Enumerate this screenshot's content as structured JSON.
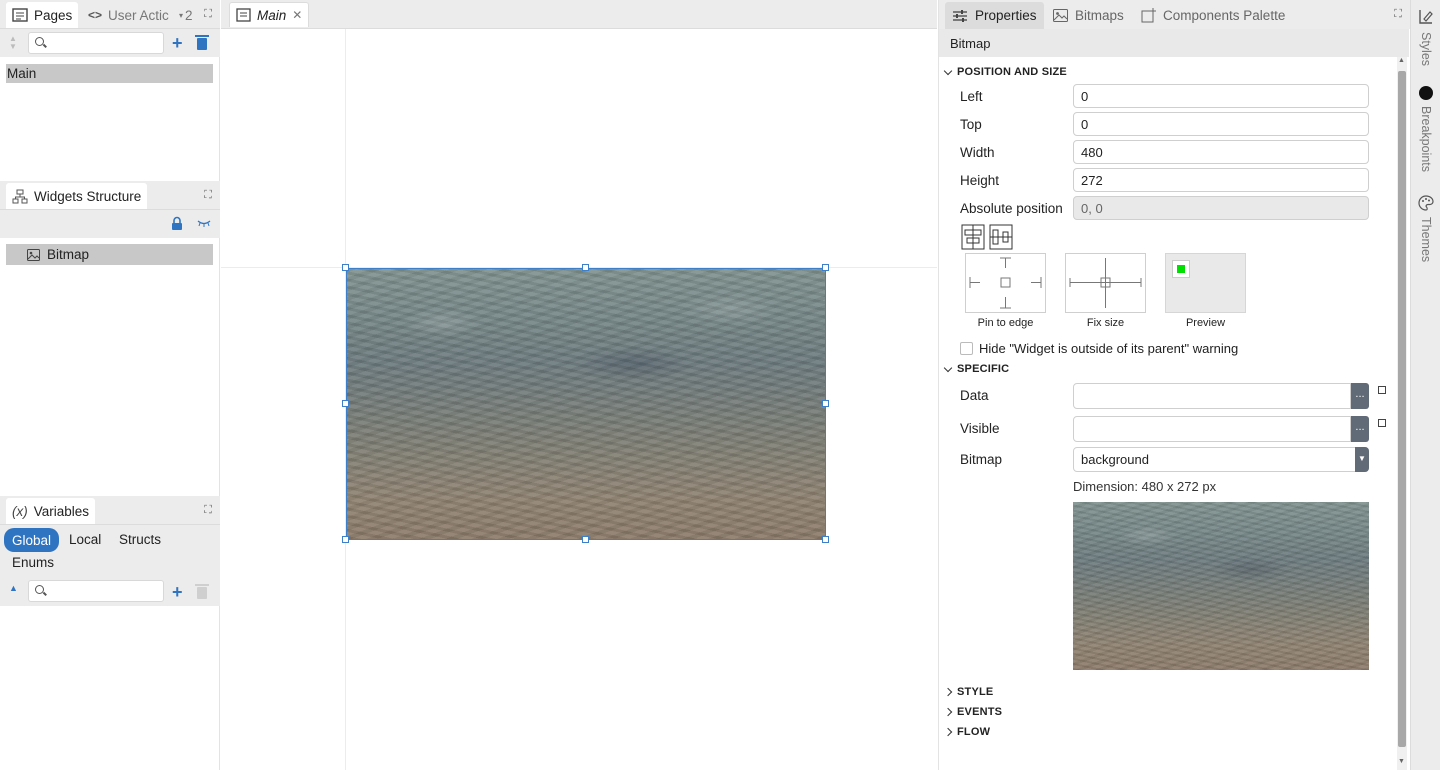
{
  "left": {
    "pages_panel": {
      "tab_pages": "Pages",
      "tab_user_actions": "User Actic",
      "overflow_count": "2",
      "search_placeholder": "",
      "items": [
        "Main"
      ]
    },
    "widgets_panel": {
      "title": "Widgets Structure",
      "items": [
        "Bitmap"
      ]
    },
    "variables_panel": {
      "icon_text": "(x)",
      "title": "Variables",
      "tabs": [
        "Global",
        "Local",
        "Structs",
        "Enums"
      ],
      "active_tab": "Global",
      "search_placeholder": ""
    }
  },
  "center": {
    "doc_tab": "Main",
    "widget_label": "Bitmap"
  },
  "right": {
    "tabs": [
      "Properties",
      "Bitmaps",
      "Components Palette"
    ],
    "breadcrumb": "Bitmap",
    "position_section": {
      "title": "POSITION AND SIZE",
      "fields": [
        {
          "label": "Left",
          "value": "0"
        },
        {
          "label": "Top",
          "value": "0"
        },
        {
          "label": "Width",
          "value": "480"
        },
        {
          "label": "Height",
          "value": "272"
        },
        {
          "label": "Absolute position",
          "value": "0, 0"
        }
      ],
      "pin_to_edge": "Pin to edge",
      "fix_size": "Fix size",
      "preview": "Preview",
      "hide_warning": "Hide \"Widget is outside of its parent\" warning"
    },
    "specific_section": {
      "title": "SPECIFIC",
      "data_label": "Data",
      "data_value": "",
      "visible_label": "Visible",
      "visible_value": "",
      "bitmap_label": "Bitmap",
      "bitmap_value": "background",
      "dimension": "Dimension: 480 x 272 px",
      "dots": "..."
    },
    "collapsed_sections": [
      "STYLE",
      "EVENTS",
      "FLOW"
    ]
  },
  "side_strip": [
    "Styles",
    "Breakpoints",
    "Themes"
  ],
  "colors": {
    "accent": "#2f74c0",
    "selection": "#3d7fc9",
    "preview_green": "#00e000"
  }
}
